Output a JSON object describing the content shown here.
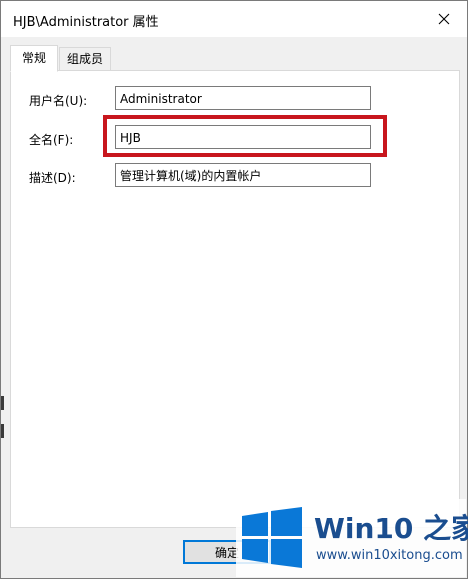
{
  "window": {
    "title": "HJB\\Administrator 属性"
  },
  "tabs": [
    {
      "label": "常规",
      "active": true
    },
    {
      "label": "组成员",
      "active": false
    }
  ],
  "fields": {
    "username": {
      "label": "用户名(U):",
      "value": "Administrator"
    },
    "fullname": {
      "label": "全名(F):",
      "value": "HJB"
    },
    "description": {
      "label": "描述(D):",
      "value": "管理计算机(域)的内置帐户"
    }
  },
  "buttons": {
    "ok_label": "确定"
  },
  "watermark": {
    "title": "Win10 之家",
    "url": "www.win10xitong.com"
  },
  "colors": {
    "highlight": "#c8161d",
    "logo_blue": "#0a78d7",
    "watermark_text": "#1a4d8f"
  }
}
